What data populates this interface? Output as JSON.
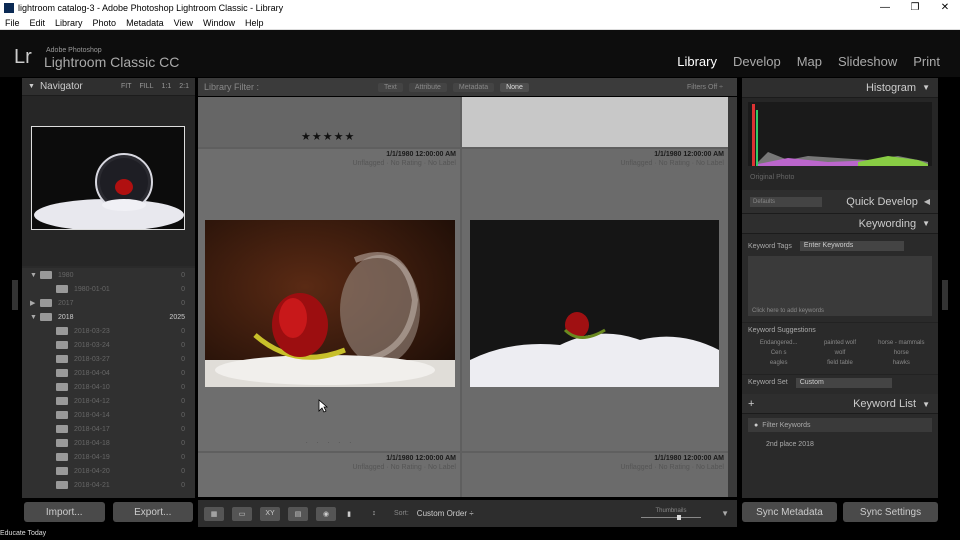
{
  "window": {
    "title": "lightroom catalog-3 - Adobe Photoshop Lightroom Classic - Library",
    "controls": [
      "—",
      "❐",
      "✕"
    ]
  },
  "menu": [
    "File",
    "Edit",
    "Library",
    "Photo",
    "Metadata",
    "View",
    "Window",
    "Help"
  ],
  "identity": {
    "logo": "Lr",
    "sub1": "Adobe Photoshop",
    "sub2": "Lightroom Classic CC"
  },
  "modules": [
    "Library",
    "Develop",
    "Map",
    "Slideshow",
    "Print"
  ],
  "left": {
    "navigator": {
      "title": "Navigator",
      "zoom": [
        "FIT",
        "FILL",
        "1:1",
        "2:1"
      ]
    },
    "folders": [
      {
        "tri": "▼",
        "name": "1980",
        "count": "0",
        "bright": false,
        "indent": 0
      },
      {
        "tri": "",
        "name": "1980-01-01",
        "count": "0",
        "bright": false,
        "indent": 1
      },
      {
        "tri": "▶",
        "name": "2017",
        "count": "0",
        "bright": false,
        "indent": 0
      },
      {
        "tri": "▼",
        "name": "2018",
        "count": "2025",
        "bright": true,
        "indent": 0
      },
      {
        "tri": "",
        "name": "2018-03-23",
        "count": "0",
        "bright": false,
        "indent": 1
      },
      {
        "tri": "",
        "name": "2018-03-24",
        "count": "0",
        "bright": false,
        "indent": 1
      },
      {
        "tri": "",
        "name": "2018-03-27",
        "count": "0",
        "bright": false,
        "indent": 1
      },
      {
        "tri": "",
        "name": "2018-04-04",
        "count": "0",
        "bright": false,
        "indent": 1
      },
      {
        "tri": "",
        "name": "2018-04-10",
        "count": "0",
        "bright": false,
        "indent": 1
      },
      {
        "tri": "",
        "name": "2018-04-12",
        "count": "0",
        "bright": false,
        "indent": 1
      },
      {
        "tri": "",
        "name": "2018-04-14",
        "count": "0",
        "bright": false,
        "indent": 1
      },
      {
        "tri": "",
        "name": "2018-04-17",
        "count": "0",
        "bright": false,
        "indent": 1
      },
      {
        "tri": "",
        "name": "2018-04-18",
        "count": "0",
        "bright": false,
        "indent": 1
      },
      {
        "tri": "",
        "name": "2018-04-19",
        "count": "0",
        "bright": false,
        "indent": 1
      },
      {
        "tri": "",
        "name": "2018-04-20",
        "count": "0",
        "bright": false,
        "indent": 1
      },
      {
        "tri": "",
        "name": "2018-04-21",
        "count": "0",
        "bright": false,
        "indent": 1
      }
    ],
    "import_label": "Import...",
    "export_label": "Export..."
  },
  "filter": {
    "title": "Library Filter :",
    "options": [
      "Text",
      "Attribute",
      "Metadata",
      "None"
    ],
    "selected": "None",
    "filters_off": "Filters Off ÷"
  },
  "grid": {
    "stars": "★★★★★",
    "cell_date": "1/1/1980 12:00:00 AM",
    "cell_flags": "Unflagged · No Rating · No Label"
  },
  "toolbar": {
    "sort_label": "Sort:",
    "sort_value": "Custom Order ÷",
    "thumbnails_label": "Thumbnails"
  },
  "right": {
    "histogram": "Histogram",
    "original_photo": "Original Photo",
    "quick_develop": "Quick Develop",
    "preset": "Defaults",
    "keywording": "Keywording",
    "keyword_tags_label": "Keyword Tags",
    "keyword_tags_value": "Enter Keywords",
    "click_hint": "Click here to add keywords",
    "keyword_suggestions": "Keyword Suggestions",
    "suggestions": [
      "Endangered...",
      "painted wolf",
      "horse - mammals",
      "Cen s",
      "wolf",
      "horse",
      "eagles",
      "field table",
      "hawks"
    ],
    "keyword_set_label": "Keyword Set",
    "keyword_set_value": "Custom",
    "keyword_list": "Keyword List",
    "filter_keywords": "Filter Keywords",
    "first_keyword": "2nd place 2018",
    "sync_metadata": "Sync Metadata",
    "sync_settings": "Sync Settings"
  },
  "watermark": "Educate Today"
}
